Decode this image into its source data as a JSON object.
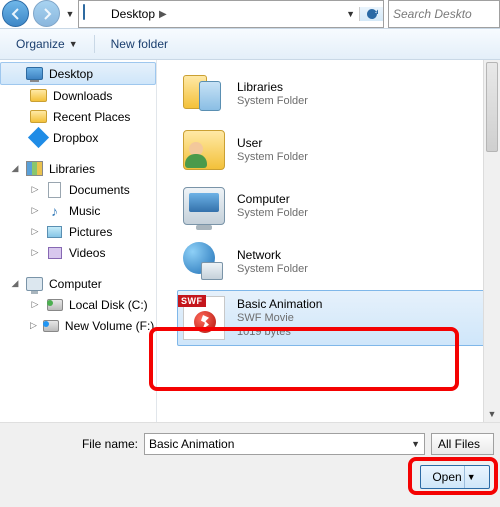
{
  "addressbar": {
    "location": "Desktop",
    "search_placeholder": "Search Deskto"
  },
  "toolbar": {
    "organize": "Organize",
    "newfolder": "New folder"
  },
  "nav": {
    "favorites": [
      {
        "label": "Desktop",
        "icon": "desktop",
        "selected": true
      },
      {
        "label": "Downloads",
        "icon": "folder"
      },
      {
        "label": "Recent Places",
        "icon": "folder"
      },
      {
        "label": "Dropbox",
        "icon": "dropbox"
      }
    ],
    "libraries_label": "Libraries",
    "libraries": [
      {
        "label": "Documents",
        "icon": "doc"
      },
      {
        "label": "Music",
        "icon": "music"
      },
      {
        "label": "Pictures",
        "icon": "pic"
      },
      {
        "label": "Videos",
        "icon": "vid"
      }
    ],
    "computer_label": "Computer",
    "computer": [
      {
        "label": "Local Disk (C:)",
        "icon": "disk-green"
      },
      {
        "label": "New Volume (F:)",
        "icon": "disk-blue"
      }
    ]
  },
  "items": [
    {
      "title": "Libraries",
      "sub1": "System Folder",
      "sub2": "",
      "icon": "lib"
    },
    {
      "title": "User",
      "sub1": "System Folder",
      "sub2": "",
      "icon": "user"
    },
    {
      "title": "Computer",
      "sub1": "System Folder",
      "sub2": "",
      "icon": "comp"
    },
    {
      "title": "Network",
      "sub1": "System Folder",
      "sub2": "",
      "icon": "net"
    },
    {
      "title": "Basic Animation",
      "sub1": "SWF Movie",
      "sub2": "1019 bytes",
      "icon": "swf",
      "selected": true
    }
  ],
  "bottom": {
    "filename_label": "File name:",
    "filename_value": "Basic Animation",
    "filter_label": "All Files",
    "open_label": "Open"
  }
}
